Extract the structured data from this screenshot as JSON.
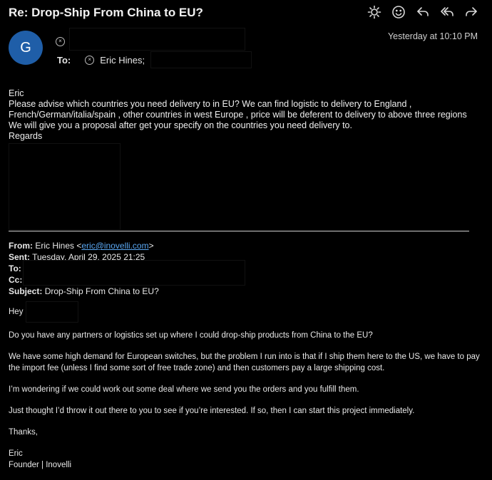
{
  "header": {
    "subject": "Re: Drop-Ship From China to EU?",
    "timestamp": "Yesterday at 10:10 PM",
    "avatar_initial": "G",
    "avatar_color": "#1f5ea8",
    "to_label": "To:",
    "to_recipient": "Eric Hines;"
  },
  "toolbar": {
    "icons": [
      "sun-icon",
      "smiley-icon",
      "reply-icon",
      "reply-all-icon",
      "forward-icon"
    ]
  },
  "reply": {
    "lines": [
      "Eric",
      "Please advise which countries you need  delivery to in EU? We can find logistic to  delivery to England ,",
      "French/German/italia/spain , other countries in west Europe , price will be deferent to delivery to above three regions",
      "We will give you a proposal after get your specify on the countries you need delivery to.",
      "Regards"
    ]
  },
  "quoted": {
    "from_label": "From:",
    "from_name": "Eric Hines <",
    "from_email": "eric@inovelli.com",
    "from_close": ">",
    "sent_label": "Sent:",
    "sent_value": "Tuesday, April 29, 2025 21:25",
    "to_label": "To:",
    "cc_label": "Cc:",
    "subject_label": "Subject:",
    "subject_value": "Drop-Ship From China to EU?",
    "greeting": "Hey",
    "paragraphs": [
      "Do you have any partners or logistics set up where I could drop-ship products from China to the EU?",
      "We have some high demand for European switches, but the problem I run into is that if I ship them here to the US, we have to pay the import fee (unless I find some sort of free trade zone) and then customers pay a large shipping cost.",
      "I’m wondering if we could work out some deal where we send you the orders and you fulfill them.",
      "Just thought I’d throw it out there to you to see if you’re interested. If so, then I can start this project immediately.",
      "Thanks,"
    ],
    "signature_name": "Eric",
    "signature_title": "Founder | Inovelli"
  }
}
